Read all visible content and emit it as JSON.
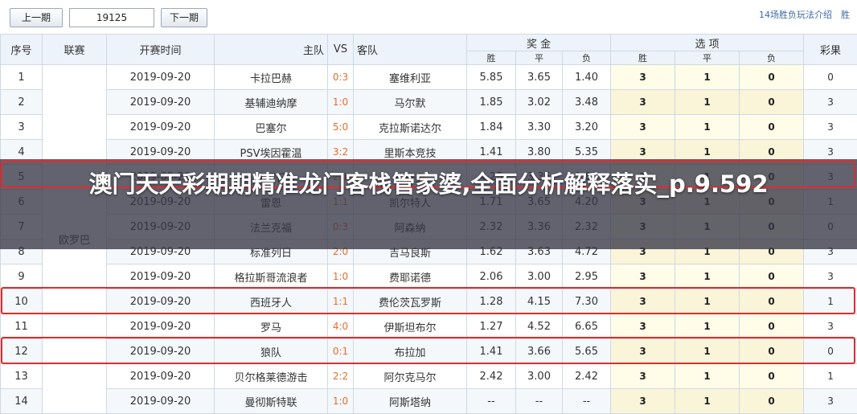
{
  "toolbar": {
    "prev_label": "上一期",
    "issue_value": "19125",
    "next_label": "下一期",
    "rule_link": "14场胜负玩法介绍",
    "more_link": "胜"
  },
  "headers": {
    "index": "序号",
    "league": "联赛",
    "time": "开赛时间",
    "home": "主队",
    "vs": "VS",
    "away": "客队",
    "bonus": "奖 金",
    "bonus_win": "胜",
    "bonus_draw": "平",
    "bonus_loss": "负",
    "options": "选 项",
    "opt_win": "胜",
    "opt_draw": "平",
    "opt_loss": "负",
    "result": "彩果"
  },
  "league_name": "欧罗巴",
  "rows": [
    {
      "no": "1",
      "time": "2019-09-20",
      "home": "卡拉巴赫",
      "score": "0:3",
      "away": "塞维利亚",
      "w": "5.85",
      "d": "3.65",
      "l": "1.40",
      "ow": "3",
      "od": "1",
      "ol": "0",
      "res": "0"
    },
    {
      "no": "2",
      "time": "2019-09-20",
      "home": "基辅迪纳摩",
      "score": "1:0",
      "away": "马尔默",
      "w": "1.85",
      "d": "3.02",
      "l": "3.48",
      "ow": "3",
      "od": "1",
      "ol": "0",
      "res": "3"
    },
    {
      "no": "3",
      "time": "2019-09-20",
      "home": "巴塞尔",
      "score": "5:0",
      "away": "克拉斯诺达尔",
      "w": "1.84",
      "d": "3.30",
      "l": "3.20",
      "ow": "3",
      "od": "1",
      "ol": "0",
      "res": "3"
    },
    {
      "no": "4",
      "time": "2019-09-20",
      "home": "PSV埃因霍温",
      "score": "3:2",
      "away": "里斯本竞技",
      "w": "1.41",
      "d": "3.80",
      "l": "5.35",
      "ow": "3",
      "od": "1",
      "ol": "0",
      "res": "3"
    },
    {
      "no": "5",
      "time": "2019-09-20",
      "home": "克罗日",
      "score": "2:1",
      "away": "拉齐奥",
      "w": "4.25",
      "d": "3.35",
      "l": "1.80",
      "ow": "3",
      "od": "1",
      "ol": "0",
      "res": "3"
    },
    {
      "no": "6",
      "time": "2019-09-20",
      "home": "雷恩",
      "score": "1:1",
      "away": "凯尔特人",
      "w": "1.71",
      "d": "3.65",
      "l": "4.20",
      "ow": "3",
      "od": "1",
      "ol": "0",
      "res": "1"
    },
    {
      "no": "7",
      "time": "2019-09-20",
      "home": "法兰克福",
      "score": "0:3",
      "away": "阿森纳",
      "w": "2.32",
      "d": "3.36",
      "l": "2.32",
      "ow": "3",
      "od": "1",
      "ol": "0",
      "res": "0"
    },
    {
      "no": "8",
      "time": "2019-09-20",
      "home": "标准列日",
      "score": "2:0",
      "away": "吉马良斯",
      "w": "1.62",
      "d": "3.63",
      "l": "4.72",
      "ow": "3",
      "od": "1",
      "ol": "0",
      "res": "3"
    },
    {
      "no": "9",
      "time": "2019-09-20",
      "home": "格拉斯哥流浪者",
      "score": "1:0",
      "away": "费耶诺德",
      "w": "2.06",
      "d": "3.00",
      "l": "2.95",
      "ow": "3",
      "od": "1",
      "ol": "0",
      "res": "3"
    },
    {
      "no": "10",
      "time": "2019-09-20",
      "home": "西班牙人",
      "score": "1:1",
      "away": "费伦茨瓦罗斯",
      "w": "1.28",
      "d": "4.15",
      "l": "7.30",
      "ow": "3",
      "od": "1",
      "ol": "0",
      "res": "1"
    },
    {
      "no": "11",
      "time": "2019-09-20",
      "home": "罗马",
      "score": "4:0",
      "away": "伊斯坦布尔",
      "w": "1.27",
      "d": "4.52",
      "l": "6.65",
      "ow": "3",
      "od": "1",
      "ol": "0",
      "res": "3"
    },
    {
      "no": "12",
      "time": "2019-09-20",
      "home": "狼队",
      "score": "0:1",
      "away": "布拉加",
      "w": "1.41",
      "d": "3.66",
      "l": "5.65",
      "ow": "3",
      "od": "1",
      "ol": "0",
      "res": "0"
    },
    {
      "no": "13",
      "time": "2019-09-20",
      "home": "贝尔格莱德游击",
      "score": "2:2",
      "away": "阿尔克马尔",
      "w": "2.42",
      "d": "3.00",
      "l": "2.42",
      "ow": "3",
      "od": "1",
      "ol": "0",
      "res": "1"
    },
    {
      "no": "14",
      "time": "2019-09-20",
      "home": "曼彻斯特联",
      "score": "1:0",
      "away": "阿斯塔纳",
      "w": "--",
      "d": "--",
      "l": "--",
      "ow": "3",
      "od": "1",
      "ol": "0",
      "res": "3"
    }
  ],
  "overlay_title": "澳门天天彩期期精准龙门客栈管家婆,全面分析解释落实_p.9.592",
  "highlight_color": "#e02c2c",
  "header_bg": "#edf3fa",
  "options_bg": "#fffde8",
  "score_color": "#e36d2e"
}
